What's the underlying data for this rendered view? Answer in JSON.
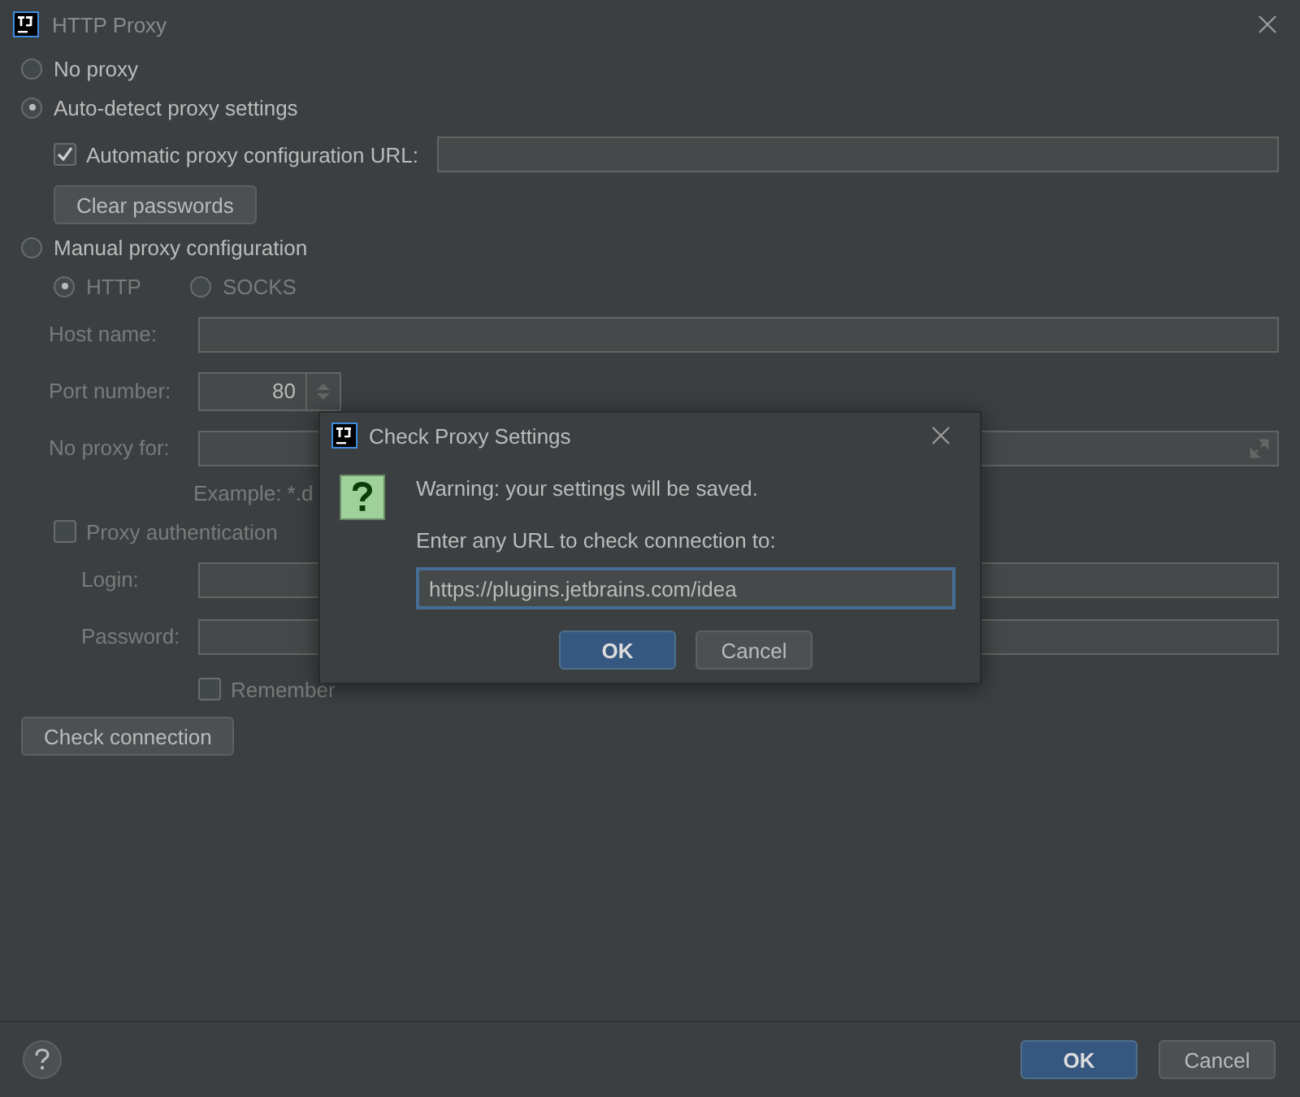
{
  "window": {
    "title": "HTTP Proxy"
  },
  "no_proxy": {
    "label": "No proxy",
    "selected": false
  },
  "auto_detect": {
    "label": "Auto-detect proxy settings",
    "selected": true,
    "pac_url": {
      "label": "Automatic proxy configuration URL:",
      "checked": true
    }
  },
  "clear_passwords_button": "Clear passwords",
  "manual": {
    "label": "Manual proxy configuration",
    "selected": false,
    "disabled": true,
    "protocols": [
      {
        "label": "HTTP",
        "selected": true
      },
      {
        "label": "SOCKS",
        "selected": false
      }
    ],
    "host_label": "Host name:",
    "port_label": "Port number:",
    "port_value": "80",
    "no_proxy_for_label": "No proxy for:",
    "example": "Example: *.d",
    "proxy_auth": {
      "label": "Proxy authentication",
      "checked": false
    },
    "login_label": "Login:",
    "password_label": "Password:",
    "remember": {
      "label": "Remember",
      "checked": false
    }
  },
  "check_connection_button": "Check connection",
  "dialog": {
    "title": "Check Proxy Settings",
    "warning": "Warning: your settings will be saved.",
    "prompt": "Enter any URL to check connection to:",
    "url": "https://plugins.jetbrains.com/idea",
    "buttons": [
      {
        "label": "OK",
        "kind": "primary"
      },
      {
        "label": "Cancel",
        "kind": "default"
      }
    ]
  },
  "footer_buttons": [
    {
      "label": "OK",
      "kind": "primary"
    },
    {
      "label": "Cancel",
      "kind": "default"
    }
  ]
}
